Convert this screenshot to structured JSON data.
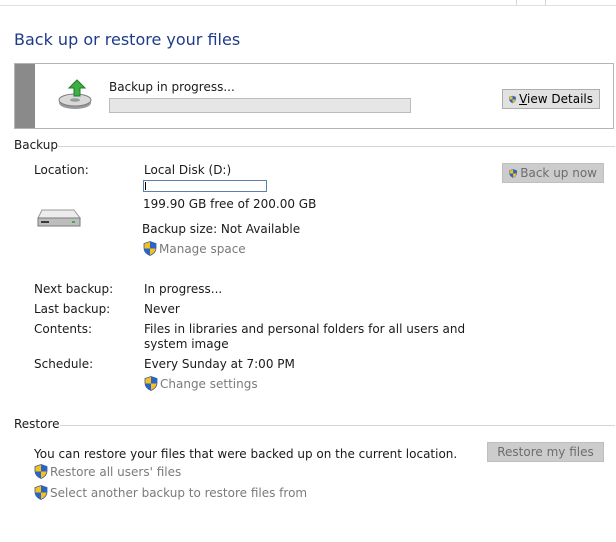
{
  "page": {
    "title": "Back up or restore your files"
  },
  "status": {
    "label": "Backup in progress...",
    "progress": 0,
    "view_details_label": "View Details",
    "view_details_mnemonic": "V",
    "view_details_rest": "iew Details"
  },
  "backup": {
    "section_label": "Backup",
    "location_label": "Location:",
    "location_value": "Local Disk (D:)",
    "free_space": "199.90 GB free of 200.00 GB",
    "size": "Backup size: Not Available",
    "manage_space_link": "Manage space",
    "backup_now_label": "Back up now",
    "next_label": "Next backup:",
    "next_value": "In progress...",
    "last_label": "Last backup:",
    "last_value": "Never",
    "contents_label": "Contents:",
    "contents_value": "Files in libraries and personal folders for all users and system image",
    "schedule_label": "Schedule:",
    "schedule_value": "Every Sunday at 7:00 PM",
    "change_settings_link": "Change settings"
  },
  "restore": {
    "section_label": "Restore",
    "description": "You can restore your files that were backed up on the current location.",
    "restore_my_files_label": "Restore my files",
    "restore_all_users_link": "Restore all users' files",
    "select_another_link": "Select another backup to restore files from"
  },
  "icons": {
    "backup_status": "backup-disk-arrow-icon",
    "drive": "hard-drive-icon",
    "uac": "uac-shield-icon"
  },
  "colors": {
    "title": "#1e3b8a",
    "link_disabled": "#7a7a7a",
    "progress_fill": "#06b025",
    "panel_accent": "#8a8a8a"
  }
}
